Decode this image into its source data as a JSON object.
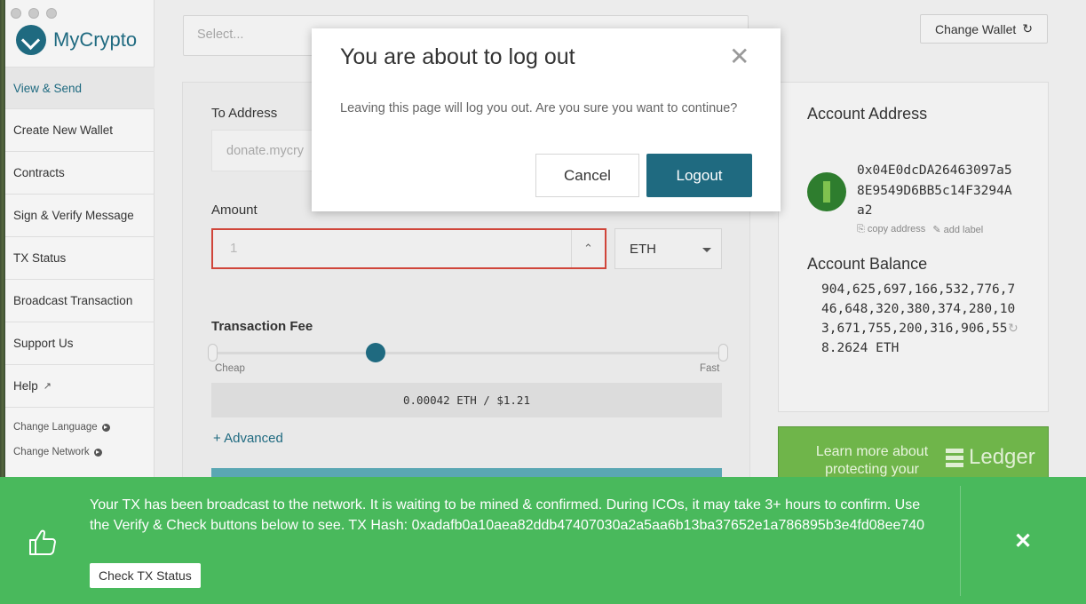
{
  "app": {
    "name": "MyCrypto"
  },
  "sidebar": {
    "items": [
      {
        "label": "View & Send"
      },
      {
        "label": "Create New Wallet"
      },
      {
        "label": "Contracts"
      },
      {
        "label": "Sign & Verify Message"
      },
      {
        "label": "TX Status"
      },
      {
        "label": "Broadcast Transaction"
      },
      {
        "label": "Support Us"
      },
      {
        "label": "Help"
      }
    ],
    "change_language": "Change Language",
    "change_network": "Change Network"
  },
  "topbar": {
    "select_placeholder": "Select...",
    "change_wallet": "Change Wallet"
  },
  "form": {
    "to_address_label": "To Address",
    "to_address_placeholder": "donate.mycry",
    "amount_label": "Amount",
    "amount_value": "1",
    "unit": "ETH",
    "fee_label": "Transaction Fee",
    "slider_min_label": "Cheap",
    "slider_max_label": "Fast",
    "fee_value": "0.00042 ETH / $1.21",
    "advanced": "+ Advanced"
  },
  "account": {
    "address_title": "Account Address",
    "address": "0x04E0dcDA26463097a58E9549D6BB5c14F3294Aa2",
    "copy_address": "copy address",
    "add_label": "add label",
    "balance_title": "Account Balance",
    "balance": "904,625,697,166,532,776,746,648,320,380,374,280,103,671,755,200,316,906,558.2624 ETH"
  },
  "ad": {
    "text": "Learn more about protecting your",
    "brand": "Ledger"
  },
  "modal": {
    "title": "You are about to log out",
    "body": "Leaving this page will log you out. Are you sure you want to continue?",
    "cancel": "Cancel",
    "logout": "Logout"
  },
  "notification": {
    "message": "Your TX has been broadcast to the network. It is waiting to be mined & confirmed. During ICOs, it may take 3+ hours to confirm. Use the Verify & Check buttons below to see. TX Hash: 0xadafb0a10aea82ddb47407030a2a5aa6b13ba37652e1a786895b3e4fd08ee740",
    "button": "Check TX Status"
  },
  "colors": {
    "accent": "#1f6a80",
    "success": "#49b95c",
    "error": "#d0453a"
  }
}
